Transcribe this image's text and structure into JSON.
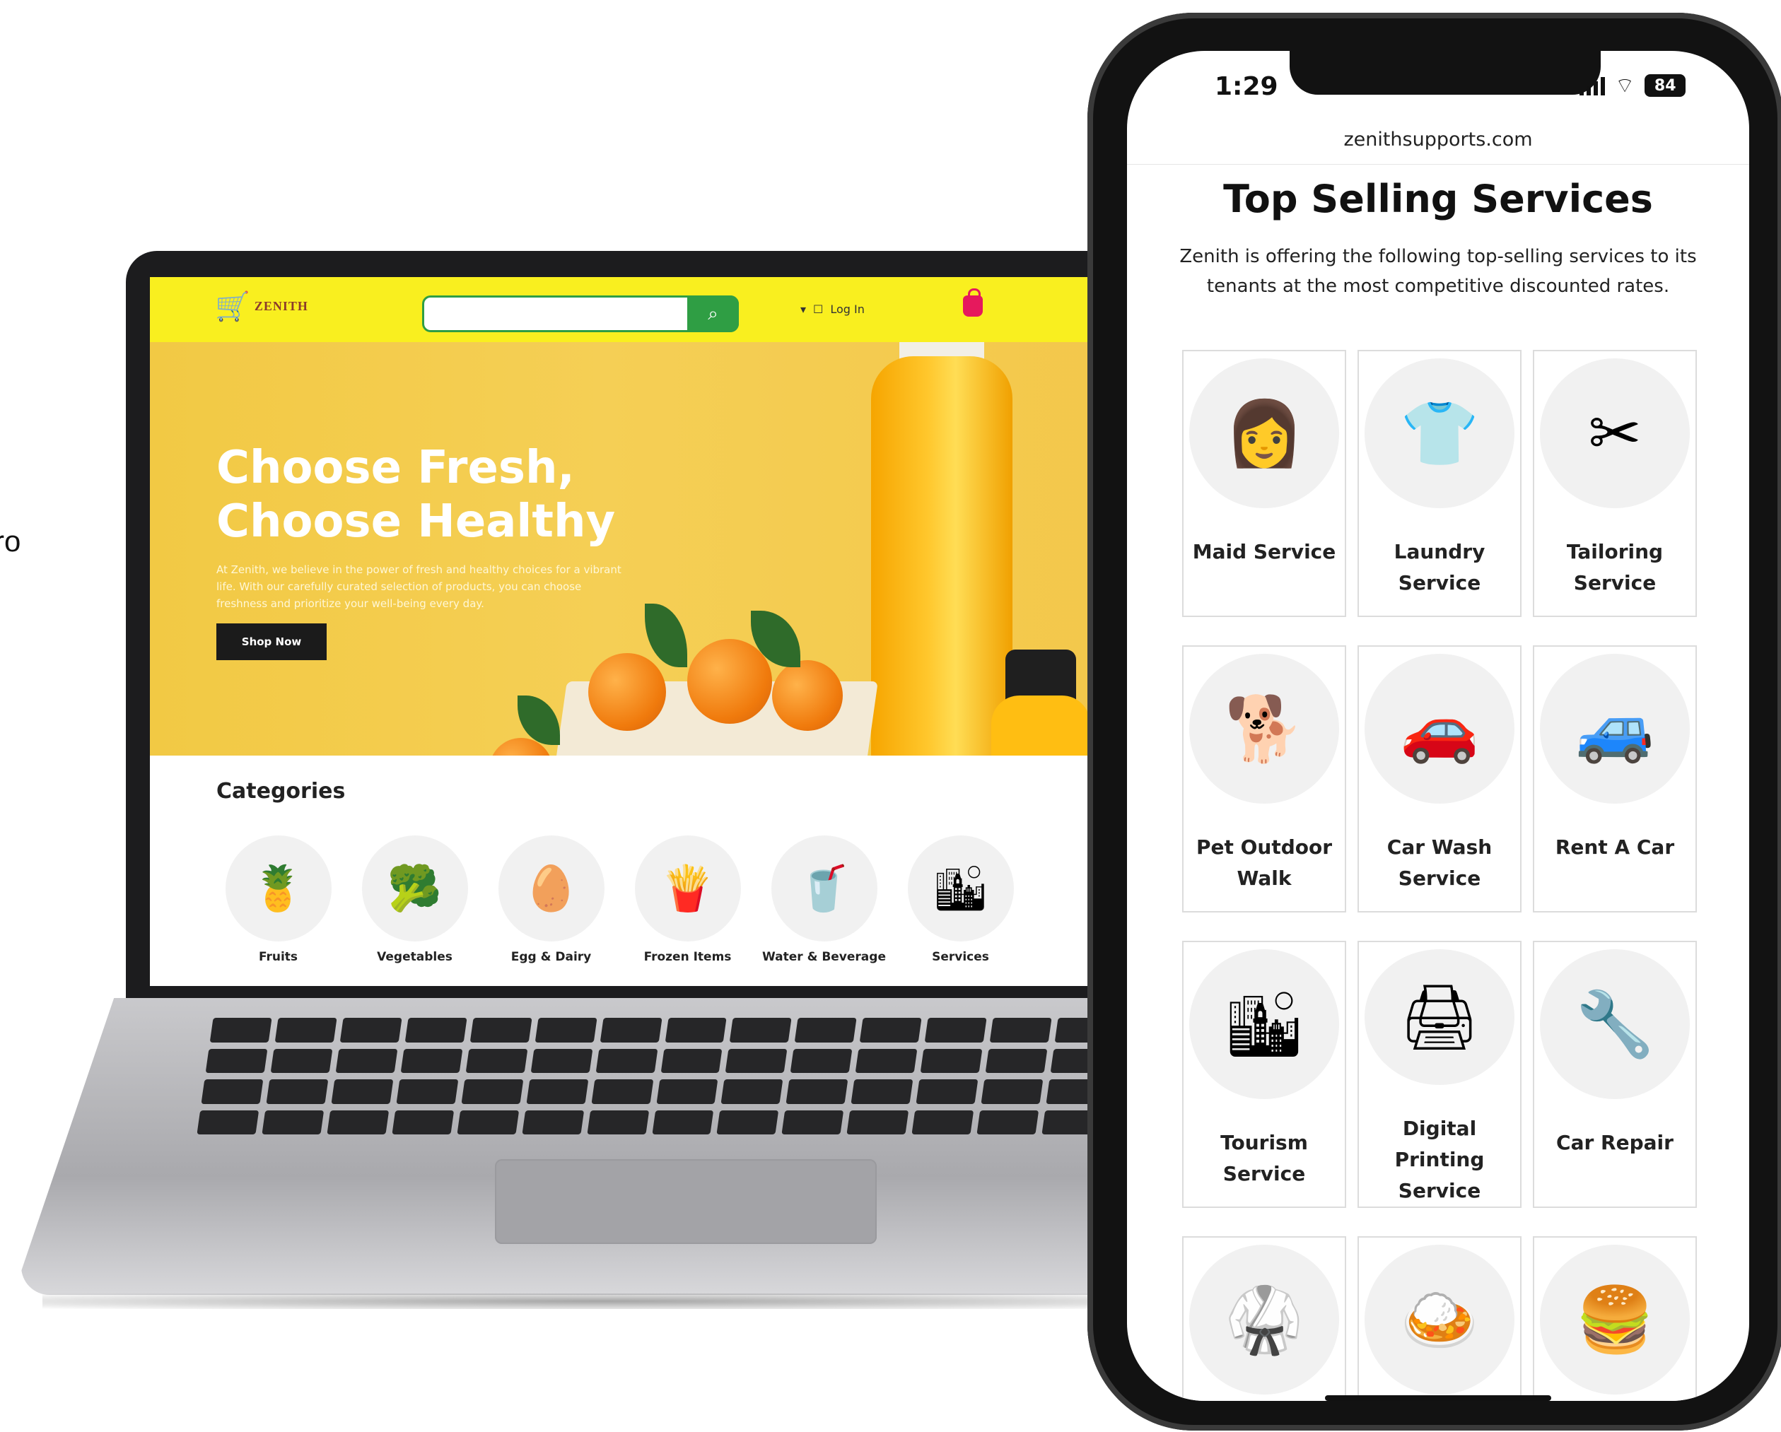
{
  "edge_text": "ro",
  "laptop": {
    "logo_text": "ZENITH",
    "login_label": "Log In",
    "hero_title_line1": "Choose Fresh,",
    "hero_title_line2": "Choose Healthy",
    "hero_subtitle": "At Zenith, we believe in the power of fresh and healthy choices for a vibrant life. With our carefully curated selection of products, you can choose freshness and prioritize your well-being every day.",
    "shop_button": "Shop Now",
    "categories_title": "Categories",
    "categories": [
      {
        "label": "Fruits",
        "icon": "🍍"
      },
      {
        "label": "Vegetables",
        "icon": "🥦"
      },
      {
        "label": "Egg & Dairy",
        "icon": "🥚"
      },
      {
        "label": "Frozen Items",
        "icon": "🍟"
      },
      {
        "label": "Water & Beverage",
        "icon": "🥤"
      },
      {
        "label": "Services",
        "icon": "🏙"
      }
    ],
    "colors": {
      "header": "#f9ef1f",
      "search_accent": "#2f9e44",
      "cart": "#e6195d"
    }
  },
  "phone": {
    "time": "1:29",
    "battery": "84",
    "url": "zenithsupports.com",
    "title": "Top Selling Services",
    "subtitle": "Zenith is offering the following top-selling services to its tenants at the most competitive discounted rates.",
    "services": [
      {
        "label": "Maid Service",
        "icon": "👩"
      },
      {
        "label": "Laundry Service",
        "icon": "👕"
      },
      {
        "label": "Tailoring Service",
        "icon": "✂"
      },
      {
        "label": "Pet Outdoor Walk",
        "icon": "🐕"
      },
      {
        "label": "Car Wash Service",
        "icon": "🚗"
      },
      {
        "label": "Rent A Car",
        "icon": "🚙"
      },
      {
        "label": "Tourism Service",
        "icon": "🏙"
      },
      {
        "label": "Digital Printing Service",
        "icon": "🖨"
      },
      {
        "label": "Car Repair",
        "icon": "🔧"
      },
      {
        "label": "",
        "icon": "🥋"
      },
      {
        "label": "",
        "icon": "🍛"
      },
      {
        "label": "",
        "icon": "🍔"
      }
    ]
  }
}
